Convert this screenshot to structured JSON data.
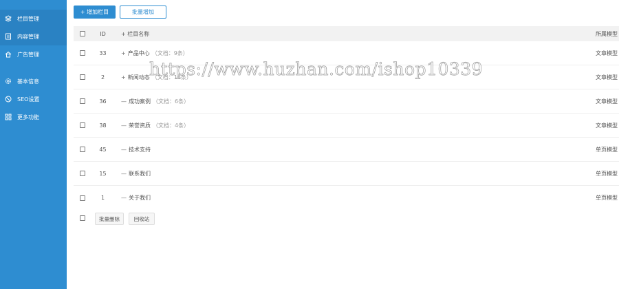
{
  "sidebar": {
    "items": [
      {
        "label": "栏目管理",
        "icon": "layers-icon"
      },
      {
        "label": "内容管理",
        "icon": "document-icon"
      },
      {
        "label": "广告管理",
        "icon": "home-icon"
      },
      {
        "label": "基本信息",
        "icon": "gear-icon"
      },
      {
        "label": "SEO设置",
        "icon": "compass-icon"
      },
      {
        "label": "更多功能",
        "icon": "grid-icon"
      }
    ]
  },
  "toolbar": {
    "add_label": "+ 增加栏目",
    "batch_label": "批量增加"
  },
  "table": {
    "headers": {
      "id": "ID",
      "name": "+ 栏目名称",
      "model": "所属模型"
    },
    "rows": [
      {
        "id": "33",
        "prefix": "+",
        "name": "产品中心",
        "note": "（文档：9条）",
        "model": "文章模型"
      },
      {
        "id": "2",
        "prefix": "+",
        "name": "新闻动态",
        "note": "（文档：16条）",
        "model": "文章模型"
      },
      {
        "id": "36",
        "prefix": "—",
        "name": "成功案例",
        "note": "（文档：6条）",
        "model": "文章模型"
      },
      {
        "id": "38",
        "prefix": "—",
        "name": "荣誉资质",
        "note": "（文档：4条）",
        "model": "文章模型"
      },
      {
        "id": "45",
        "prefix": "—",
        "name": "技术支持",
        "note": "",
        "model": "单页模型"
      },
      {
        "id": "15",
        "prefix": "—",
        "name": "联系我们",
        "note": "",
        "model": "单页模型"
      },
      {
        "id": "1",
        "prefix": "—",
        "name": "关于我们",
        "note": "",
        "model": "单页模型"
      }
    ]
  },
  "footer": {
    "delete_label": "批量删除",
    "recycle_label": "回收站"
  },
  "watermark": "https://www.huzhan.com/ishop10339",
  "colors": {
    "accent": "#2e8dd1",
    "sidebar_active": "#2a82c3"
  }
}
